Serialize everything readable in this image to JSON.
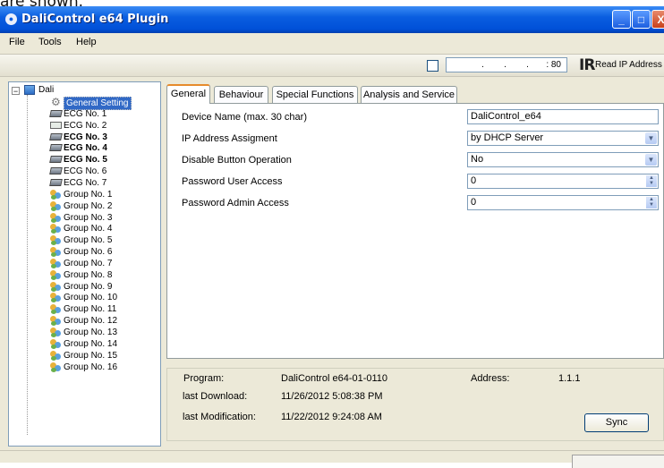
{
  "caption_text": "are shown.",
  "window": {
    "title": "DaliControl e64 Plugin",
    "minimize_glyph": "_",
    "maximize_glyph": "□",
    "close_glyph": "X"
  },
  "menu": {
    "items": [
      "File",
      "Tools",
      "Help"
    ]
  },
  "toolbar": {
    "ip_address_value": ".        .        .       : 80",
    "ir_glyph": "IR",
    "read_ip_label": "Read IP Address"
  },
  "tree": {
    "expander_glyph": "−",
    "root_label": "Dali",
    "items": [
      {
        "label": "General Setting",
        "icon": "gear-icon",
        "bold": false,
        "selected": true
      },
      {
        "label": "ECG No. 1",
        "icon": "ecg-lamp-icon",
        "bold": false,
        "selected": false
      },
      {
        "label": "ECG No. 2",
        "icon": "ecg-switch-icon",
        "bold": false,
        "selected": false
      },
      {
        "label": "ECG No. 3",
        "icon": "ecg-lamp-icon",
        "bold": true,
        "selected": false
      },
      {
        "label": "ECG No. 4",
        "icon": "ecg-lamp-icon",
        "bold": true,
        "selected": false
      },
      {
        "label": "ECG No. 5",
        "icon": "ecg-lamp-icon",
        "bold": true,
        "selected": false
      },
      {
        "label": "ECG No. 6",
        "icon": "ecg-lamp-icon",
        "bold": false,
        "selected": false
      },
      {
        "label": "ECG No. 7",
        "icon": "ecg-lamp-icon",
        "bold": false,
        "selected": false
      },
      {
        "label": "Group No. 1",
        "icon": "group-icon",
        "bold": false,
        "selected": false
      },
      {
        "label": "Group No. 2",
        "icon": "group-icon",
        "bold": false,
        "selected": false
      },
      {
        "label": "Group No. 3",
        "icon": "group-icon",
        "bold": false,
        "selected": false
      },
      {
        "label": "Group No. 4",
        "icon": "group-icon",
        "bold": false,
        "selected": false
      },
      {
        "label": "Group No. 5",
        "icon": "group-icon",
        "bold": false,
        "selected": false
      },
      {
        "label": "Group No. 6",
        "icon": "group-icon",
        "bold": false,
        "selected": false
      },
      {
        "label": "Group No. 7",
        "icon": "group-icon",
        "bold": false,
        "selected": false
      },
      {
        "label": "Group No. 8",
        "icon": "group-icon",
        "bold": false,
        "selected": false
      },
      {
        "label": "Group No. 9",
        "icon": "group-icon",
        "bold": false,
        "selected": false
      },
      {
        "label": "Group No. 10",
        "icon": "group-icon",
        "bold": false,
        "selected": false
      },
      {
        "label": "Group No. 11",
        "icon": "group-icon",
        "bold": false,
        "selected": false
      },
      {
        "label": "Group No. 12",
        "icon": "group-icon",
        "bold": false,
        "selected": false
      },
      {
        "label": "Group No. 13",
        "icon": "group-icon",
        "bold": false,
        "selected": false
      },
      {
        "label": "Group No. 14",
        "icon": "group-icon",
        "bold": false,
        "selected": false
      },
      {
        "label": "Group No. 15",
        "icon": "group-icon",
        "bold": false,
        "selected": false
      },
      {
        "label": "Group No. 16",
        "icon": "group-icon",
        "bold": false,
        "selected": false
      }
    ]
  },
  "tabs": [
    {
      "label": "General",
      "active": true
    },
    {
      "label": "Behaviour",
      "active": false
    },
    {
      "label": "Special Functions",
      "active": false
    },
    {
      "label": "Analysis and Service",
      "active": false
    }
  ],
  "form": {
    "device_name": {
      "label": "Device Name (max. 30 char)",
      "value": "DaliControl_e64"
    },
    "ip_assignment": {
      "label": "IP Address Assigment",
      "value": "by DHCP Server"
    },
    "disable_button": {
      "label": "Disable Button Operation",
      "value": "No"
    },
    "password_user": {
      "label": "Password User Access",
      "value": "0"
    },
    "password_admin": {
      "label": "Password Admin Access",
      "value": "0"
    }
  },
  "info": {
    "program_label": "Program:",
    "program_value": "DaliControl  e64-01-0110",
    "address_label": "Address:",
    "address_value": "1.1.1",
    "download_label": "last Download:",
    "download_value": "11/26/2012 5:08:38 PM",
    "modification_label": "last Modification:",
    "modification_value": "11/22/2012 9:24:08 AM",
    "sync_label": "Sync"
  },
  "glyphs": {
    "dropdown": "▼",
    "spin_up": "▲",
    "spin_down": "▼",
    "gear": "⚙"
  },
  "colors": {
    "titlebar": "#0a5ee0",
    "selection": "#3169c6",
    "tab_accent": "#e68b2c",
    "window_bg": "#ece9d8"
  }
}
